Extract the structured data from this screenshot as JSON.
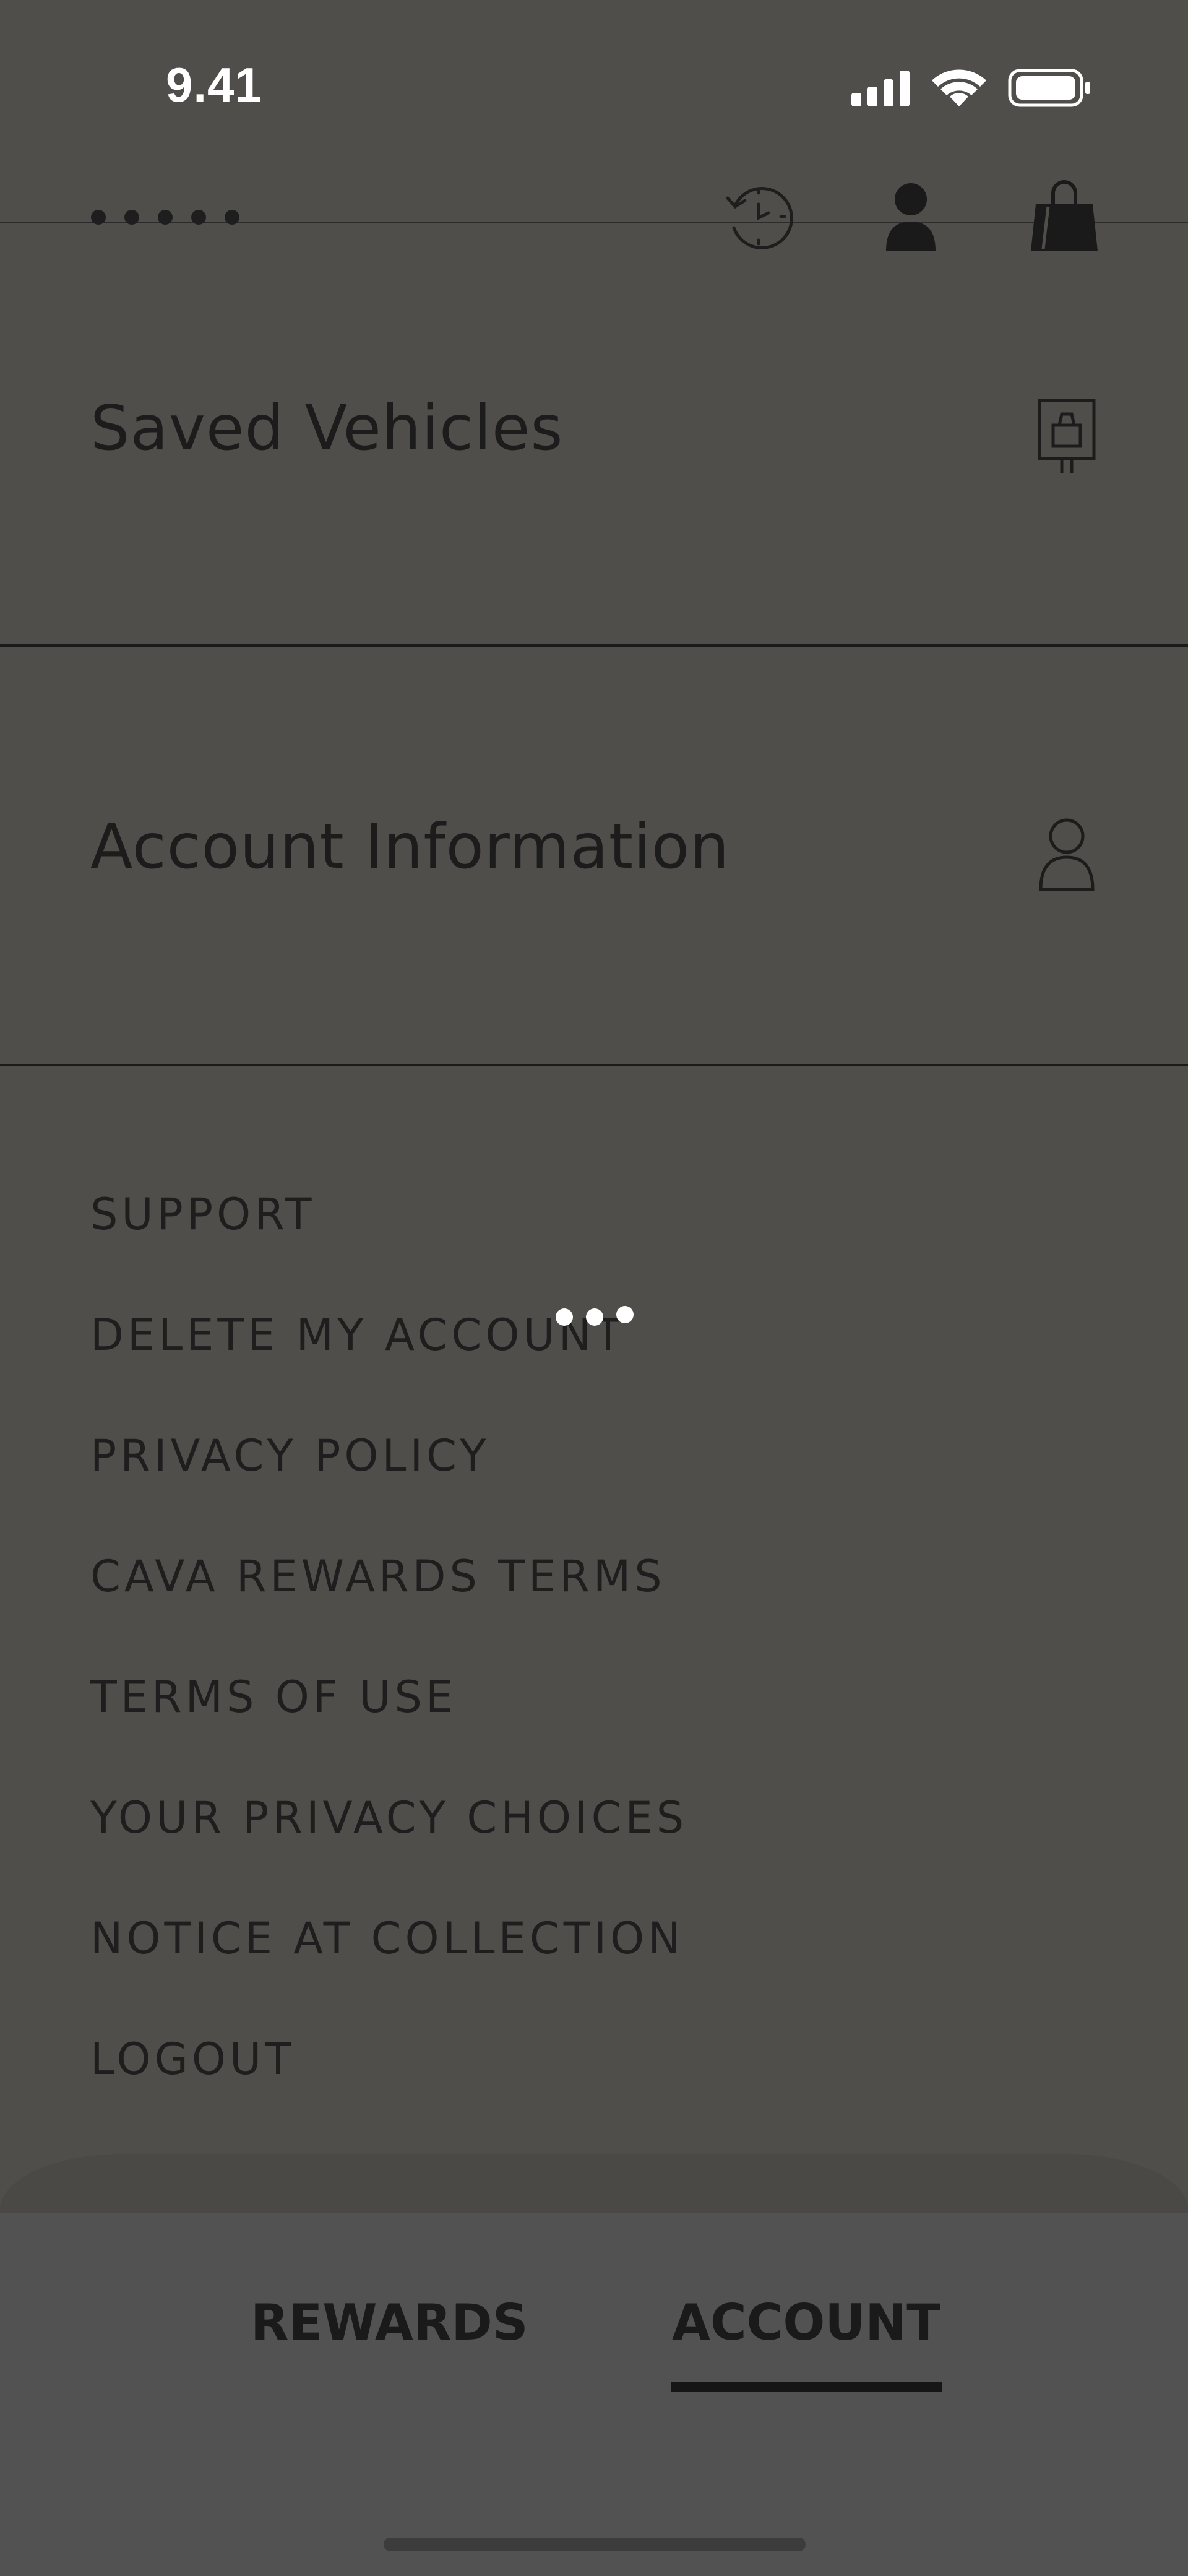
{
  "status_bar": {
    "time": "9.41"
  },
  "top_bar": {
    "logo_icon": "dots-logo-icon",
    "recent_orders_icon": "history-clock-icon",
    "account_icon": "person-filled-icon",
    "bag_icon": "shopping-bag-icon"
  },
  "rows": [
    {
      "label": "Saved Vehicles",
      "icon": "car-sign-icon"
    },
    {
      "label": "Account Information",
      "icon": "person-outline-icon"
    }
  ],
  "links": [
    "SUPPORT",
    "DELETE MY ACCOUNT",
    "PRIVACY POLICY",
    "CAVA REWARDS TERMS",
    "TERMS OF USE",
    "YOUR PRIVACY CHOICES",
    "NOTICE AT COLLECTION",
    "LOGOUT"
  ],
  "tabs": {
    "rewards": "REWARDS",
    "account": "ACCOUNT",
    "selected": "ACCOUNT"
  },
  "colors": {
    "background": "#4f4e4b",
    "tabbar": "#525252",
    "text": "#1c1c1c",
    "status_text": "#ffffff"
  }
}
